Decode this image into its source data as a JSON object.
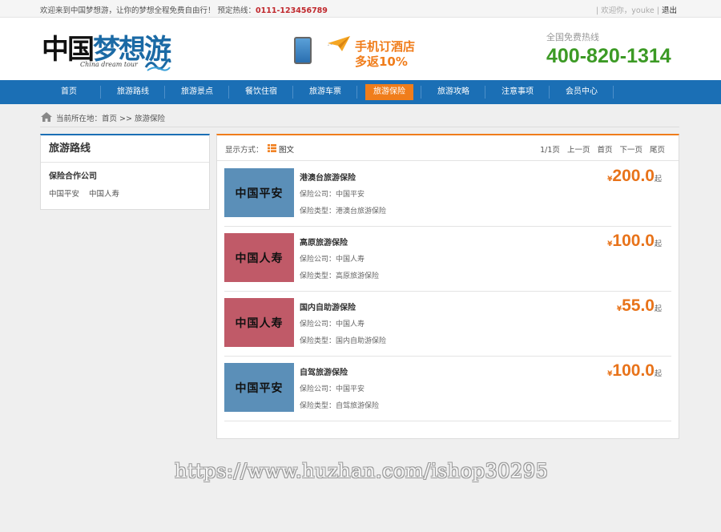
{
  "topbar": {
    "welcome": "欢迎来到中国梦想游，让你的梦想全程免费自由行！ 预定热线：",
    "hotline": "0111-123456789",
    "user": "| 欢迎你，youke |",
    "logout": "退出"
  },
  "header": {
    "logo_cn_black": "中国",
    "logo_cn_blue": "梦想游",
    "logo_en": "China dream tour",
    "promo_line1": "手机订酒店",
    "promo_line2": "多返10%",
    "hotline_label": "全国免费热线",
    "hotline_number": "400-820-1314"
  },
  "nav": {
    "items": [
      "首页",
      "旅游路线",
      "旅游景点",
      "餐饮住宿",
      "旅游车票",
      "旅游保险",
      "旅游攻略",
      "注意事项",
      "会员中心"
    ],
    "active_index": 5
  },
  "breadcrumb": {
    "text": "当前所在地：首页 >> 旅游保险"
  },
  "sidebar": {
    "title": "旅游路线",
    "subtitle": "保险合作公司",
    "links": [
      "中国平安",
      "中国人寿"
    ]
  },
  "toolbar": {
    "display_label": "显示方式：",
    "mode": "图文"
  },
  "pager": {
    "page": "1/1页",
    "prev": "上一页",
    "first": "首页",
    "next": "下一页",
    "last": "尾页"
  },
  "products": [
    {
      "thumb": "中国平安",
      "name": "港澳台旅游保险",
      "company": "保险公司：中国平安",
      "type": "保险类型：港澳台旅游保险",
      "currency": "¥",
      "price": "200.0",
      "suffix": "起"
    },
    {
      "thumb": "中国人寿",
      "name": "高原旅游保险",
      "company": "保险公司：中国人寿",
      "type": "保险类型：高原旅游保险",
      "currency": "¥",
      "price": "100.0",
      "suffix": "起"
    },
    {
      "thumb": "中国人寿",
      "name": "国内自助游保险",
      "company": "保险公司：中国人寿",
      "type": "保险类型：国内自助游保险",
      "currency": "¥",
      "price": "55.0",
      "suffix": "起"
    },
    {
      "thumb": "中国平安",
      "name": "自驾旅游保险",
      "company": "保险公司：中国平安",
      "type": "保险类型：自驾旅游保险",
      "currency": "¥",
      "price": "100.0",
      "suffix": "起"
    }
  ],
  "watermark": "https://www.huzhan.com/ishop30295",
  "colors": {
    "nav_blue": "#1b6fb5",
    "accent_orange": "#f07d1b",
    "hotline_green": "#3c9a25",
    "pingan_thumb": "#5b8fb8",
    "renshou_thumb": "#c05a68"
  }
}
